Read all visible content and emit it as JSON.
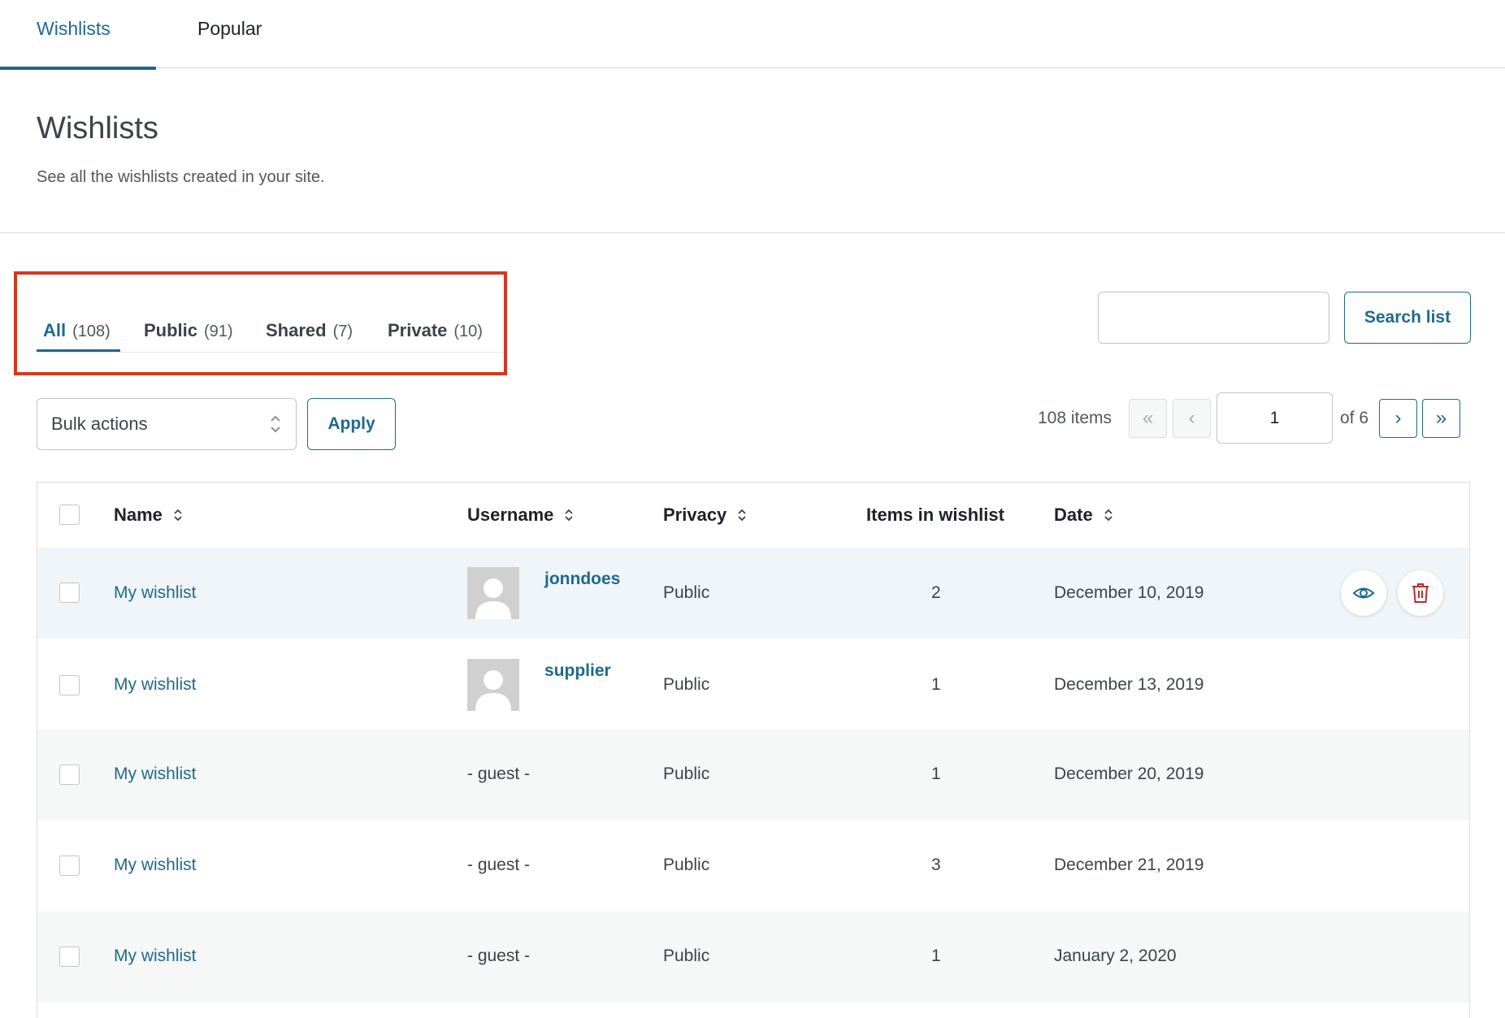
{
  "top_tabs": [
    {
      "label": "Wishlists",
      "active": true
    },
    {
      "label": "Popular",
      "active": false
    }
  ],
  "page": {
    "title": "Wishlists",
    "description": "See all the wishlists created in your site."
  },
  "filters": [
    {
      "label": "All",
      "count": "(108)",
      "active": true
    },
    {
      "label": "Public",
      "count": "(91)",
      "active": false
    },
    {
      "label": "Shared",
      "count": "(7)",
      "active": false
    },
    {
      "label": "Private",
      "count": "(10)",
      "active": false
    }
  ],
  "search": {
    "value": "",
    "button_label": "Search list"
  },
  "bulk": {
    "selected": "Bulk actions",
    "apply_label": "Apply"
  },
  "pagination": {
    "items_label": "108 items",
    "first": "«",
    "prev": "‹",
    "current_page": "1",
    "of_label": "of 6",
    "next": "›",
    "last": "»"
  },
  "table": {
    "columns": {
      "name": "Name",
      "username": "Username",
      "privacy": "Privacy",
      "items": "Items in wishlist",
      "date": "Date"
    },
    "rows": [
      {
        "name": "My wishlist",
        "username": "jonndoes",
        "privacy": "Public",
        "items": "2",
        "date": "December 10, 2019"
      },
      {
        "name": "My wishlist",
        "username": "supplier",
        "privacy": "Public",
        "items": "1",
        "date": "December 13, 2019"
      },
      {
        "name": "My wishlist",
        "username": "- guest -",
        "privacy": "Public",
        "items": "1",
        "date": "December 20, 2019"
      },
      {
        "name": "My wishlist",
        "username": "- guest -",
        "privacy": "Public",
        "items": "3",
        "date": "December 21, 2019"
      },
      {
        "name": "My wishlist",
        "username": "- guest -",
        "privacy": "Public",
        "items": "1",
        "date": "January 2, 2020"
      }
    ]
  },
  "icons": {
    "view": "eye-icon",
    "delete": "trash-icon",
    "sort": "sort-arrows-icon",
    "select": "chevron-updown-icon",
    "avatar": "user-silhouette-icon"
  },
  "colors": {
    "accent": "#1d6a8e",
    "highlight": "#d2391f",
    "delete": "#b32d2e"
  }
}
